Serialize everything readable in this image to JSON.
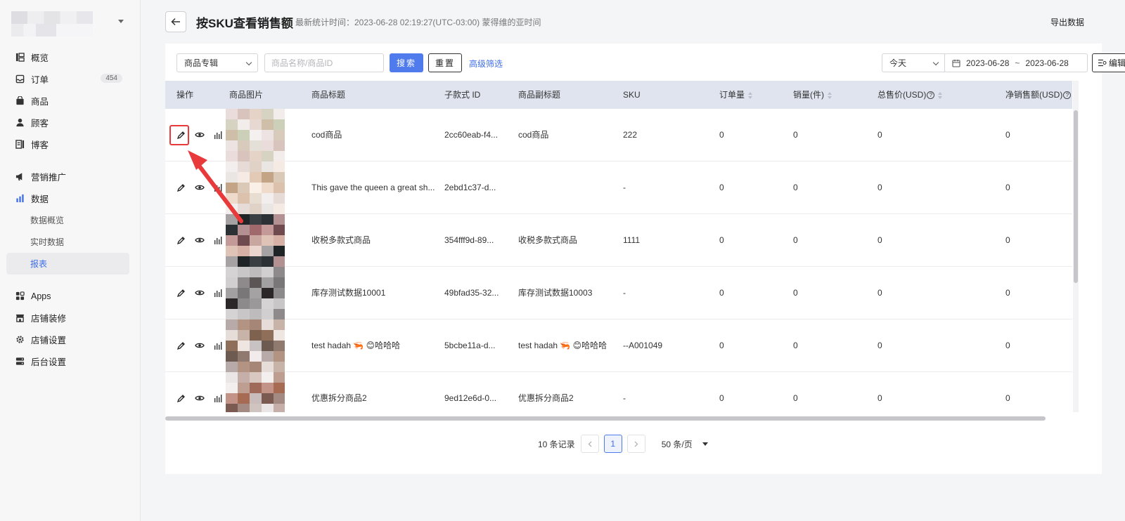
{
  "sidebar": {
    "nav": [
      {
        "label": "概览",
        "icon": "overview-icon"
      },
      {
        "label": "订单",
        "icon": "orders-icon",
        "badge": "454"
      },
      {
        "label": "商品",
        "icon": "products-icon"
      },
      {
        "label": "顾客",
        "icon": "customers-icon"
      },
      {
        "label": "博客",
        "icon": "blog-icon"
      }
    ],
    "nav2": [
      {
        "label": "营销推广",
        "icon": "marketing-icon"
      },
      {
        "label": "数据",
        "icon": "data-icon"
      }
    ],
    "data_sub": [
      "数据概览",
      "实时数据",
      "报表"
    ],
    "nav3": [
      {
        "label": "Apps",
        "icon": "apps-icon"
      },
      {
        "label": "店铺装修",
        "icon": "store-decoration-icon"
      },
      {
        "label": "店铺设置",
        "icon": "store-settings-icon"
      },
      {
        "label": "后台设置",
        "icon": "admin-settings-icon"
      }
    ]
  },
  "header": {
    "title": "按SKU查看销售额",
    "stat_time": "最新统计时间：2023-06-28 02:19:27(UTC-03:00) 蒙得维的亚时间",
    "export_label": "导出数据"
  },
  "filters": {
    "group_select": "商品专辑",
    "search_placeholder": "商品名称/商品ID",
    "search_label": "搜索",
    "reset_label": "重置",
    "advanced_label": "高级筛选",
    "date_preset": "今天",
    "date_start": "2023-06-28",
    "date_sep": "~",
    "date_end": "2023-06-28",
    "edit_columns_label": "编辑表头"
  },
  "table": {
    "columns": [
      "操作",
      "商品图片",
      "商品标题",
      "子款式 ID",
      "商品副标题",
      "SKU",
      "订单量",
      "销量(件)",
      "总售价(USD)",
      "净销售额(USD)"
    ],
    "rows": [
      {
        "title": "cod商品",
        "variant_id": "2cc60eab-f4...",
        "subtitle": "cod商品",
        "sku": "222",
        "orders": "0",
        "qty": "0",
        "gross": "0",
        "net": "0"
      },
      {
        "title": "This gave the queen a great sh...",
        "variant_id": "2ebd1c37-d...",
        "subtitle": "",
        "sku": "-",
        "orders": "0",
        "qty": "0",
        "gross": "0",
        "net": "0"
      },
      {
        "title": "收税多款式商品",
        "variant_id": "354fff9d-89...",
        "subtitle": "收税多款式商品",
        "sku": "1111",
        "orders": "0",
        "qty": "0",
        "gross": "0",
        "net": "0"
      },
      {
        "title": "库存测试数据10001",
        "variant_id": "49bfad35-32...",
        "subtitle": "库存测试数据10003",
        "sku": "-",
        "orders": "0",
        "qty": "0",
        "gross": "0",
        "net": "0"
      },
      {
        "title": "test hadah 🦐 😊哈哈哈",
        "variant_id": "5bcbe11a-d...",
        "subtitle": "test hadah 🦐 😊哈哈哈",
        "sku": "--A001049",
        "orders": "0",
        "qty": "0",
        "gross": "0",
        "net": "0"
      },
      {
        "title": "优惠拆分商品2",
        "variant_id": "9ed12e6d-0...",
        "subtitle": "优惠拆分商品2",
        "sku": "-",
        "orders": "0",
        "qty": "0",
        "gross": "0",
        "net": "0"
      }
    ]
  },
  "pagination": {
    "total": "10 条记录",
    "current_page": "1",
    "page_size": "50 条/页"
  },
  "colors": {
    "primary": "#4f7bec",
    "header_bg": "#dfe4ef",
    "annotation_red": "#e83a3a"
  }
}
